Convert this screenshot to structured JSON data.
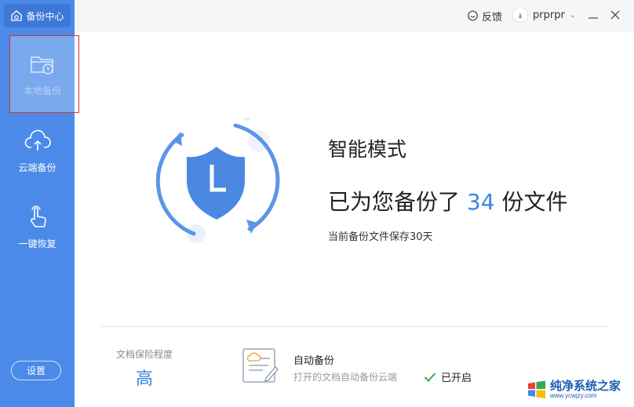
{
  "app": {
    "badge_label": "备份中心"
  },
  "sidebar": {
    "items": [
      {
        "label": "本地备份",
        "icon": "folder-clock-icon"
      },
      {
        "label": "云端备份",
        "icon": "cloud-upload-icon"
      },
      {
        "label": "一键恢复",
        "icon": "hand-tap-icon"
      }
    ],
    "settings_label": "设置"
  },
  "header": {
    "feedback_label": "反馈",
    "username": "prprpr"
  },
  "main": {
    "mode_title": "智能模式",
    "backup_prefix": "已为您备份了",
    "backup_count": "34",
    "backup_suffix": "份文件",
    "retention_text": "当前备份文件保存30天"
  },
  "footer": {
    "protect_label": "文档保险程度",
    "protect_level": "高",
    "auto_title": "自动备份",
    "auto_desc": "打开的文档自动备份云端",
    "status_label": "已开启"
  },
  "watermark": {
    "title": "纯净系统之家",
    "url": "www.ycwjzy.com"
  },
  "colors": {
    "sidebar": "#4b8ae8",
    "accent": "#3a86e0",
    "status_check": "#3aaa55"
  }
}
